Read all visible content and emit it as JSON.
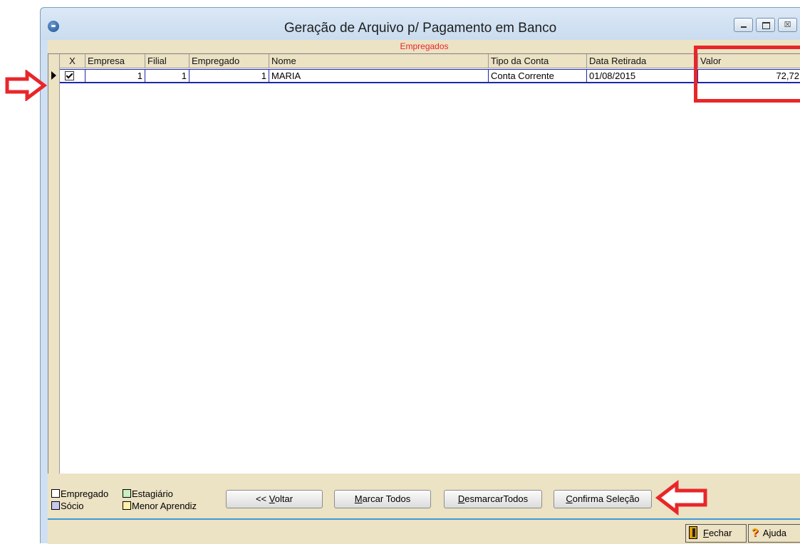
{
  "window": {
    "title": "Geração de Arquivo p/ Pagamento em Banco",
    "controls": {
      "min": "",
      "max": "",
      "close": "☒"
    }
  },
  "grid": {
    "caption": "Empregados",
    "columns": [
      "X",
      "Empresa",
      "Filial",
      "Empregado",
      "Nome",
      "Tipo da Conta",
      "Data Retirada",
      "Valor"
    ],
    "rows": [
      {
        "checked": true,
        "empresa": "1",
        "filial": "1",
        "empregado": "1",
        "nome": "MARIA",
        "tipo_conta": "Conta Corrente",
        "data_retirada": "01/08/2015",
        "valor": "72,72"
      }
    ]
  },
  "legend": {
    "items": [
      {
        "label": "Empregado",
        "color": "#ffffff"
      },
      {
        "label": "Estagiário",
        "color": "#c8f0c0"
      },
      {
        "label": "Sócio",
        "color": "#c8c8f0"
      },
      {
        "label": "Menor Aprendiz",
        "color": "#fff2a8"
      }
    ]
  },
  "buttons": {
    "voltar_prefix": "<< ",
    "voltar_key": "V",
    "voltar_rest": "oltar",
    "marcar_key": "M",
    "marcar_rest": "arcar Todos",
    "desmarcar_key": "D",
    "desmarcar_rest": "esmarcarTodos",
    "confirma_key": "C",
    "confirma_rest": "onfirma Seleção",
    "fechar_key": "F",
    "fechar_rest": "echar",
    "ajuda_label": "Ajuda"
  },
  "colors": {
    "annotation": "#e8262a",
    "grid_caption": "#e8262a",
    "row_border": "#1b2aa6",
    "panel": "#ece2c4"
  }
}
